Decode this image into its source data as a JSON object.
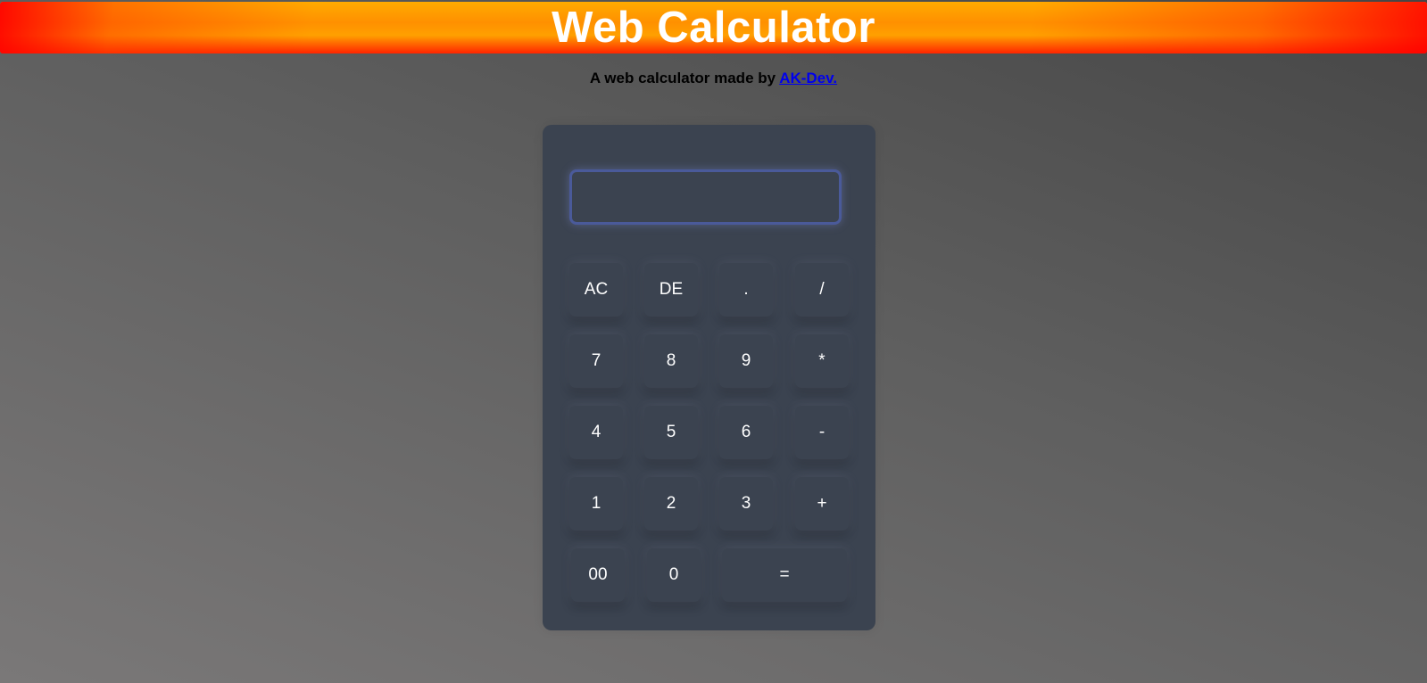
{
  "header": {
    "title": "Web Calculator"
  },
  "subtitle": {
    "text": "A web calculator made by ",
    "link_text": "AK-Dev."
  },
  "calculator": {
    "display_value": "",
    "buttons": {
      "ac": "AC",
      "de": "DE",
      "dot": ".",
      "divide": "/",
      "seven": "7",
      "eight": "8",
      "nine": "9",
      "multiply": "*",
      "four": "4",
      "five": "5",
      "six": "6",
      "minus": "-",
      "one": "1",
      "two": "2",
      "three": "3",
      "plus": "+",
      "double_zero": "00",
      "zero": "0",
      "equals": "="
    }
  },
  "colors": {
    "panel": "#3b4350",
    "display_border": "#4a5a9a",
    "header_orange": "#ff9000",
    "header_red": "#ff2400",
    "link": "#0000ee"
  }
}
